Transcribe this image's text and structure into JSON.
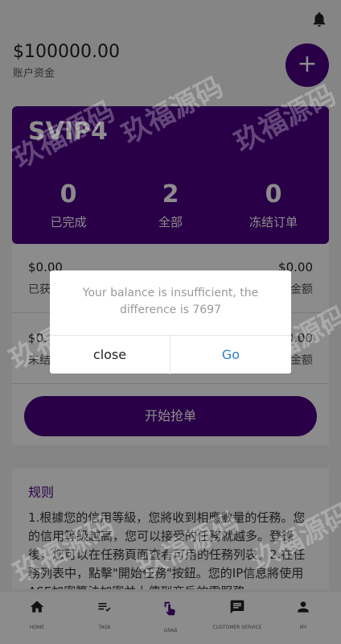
{
  "header": {
    "balance": "$100000.00",
    "balance_label": "账户资金",
    "fab_label": "+"
  },
  "vip_card": {
    "title": "SVIP4",
    "stats": [
      {
        "value": "0",
        "label": "已完成"
      },
      {
        "value": "2",
        "label": "全部"
      },
      {
        "value": "0",
        "label": "冻结订单"
      }
    ]
  },
  "panel": {
    "rows": [
      {
        "left_amount": "$0.00",
        "left_label": "已获",
        "right_amount": "$0.00",
        "right_label": "金额"
      },
      {
        "left_amount": "$0.",
        "left_label": "未结",
        "right_amount": "0.00",
        "right_label": "金额"
      }
    ]
  },
  "start_button": "开始抢单",
  "rules": {
    "title": "规则",
    "body": "1.根據您的信用等級，您將收到相應數量的任務。您的信用等級越高，您可以接受的任務就越多。登錄後，您可以在任務頁面查看可用的任務列表。2.在任務列表中，點擊\"開始任務\"按鈕。您的IP信息將使用ASE加密算法加密并上傳到商戶的雲服務"
  },
  "tabs": [
    {
      "label": "HOME",
      "icon": "home-icon"
    },
    {
      "label": "TASK",
      "icon": "task-list-icon"
    },
    {
      "label": "GRAB",
      "icon": "tap-icon"
    },
    {
      "label": "CUSTOMER SERVICE",
      "icon": "chat-icon"
    },
    {
      "label": "MY",
      "icon": "person-icon"
    }
  ],
  "dialog": {
    "message": "Your balance is insufficient, the difference is 7697",
    "close_label": "close",
    "go_label": "Go"
  },
  "watermark": "玖福源码",
  "colors": {
    "accent": "#4b0082",
    "link": "#2e7ec8"
  }
}
